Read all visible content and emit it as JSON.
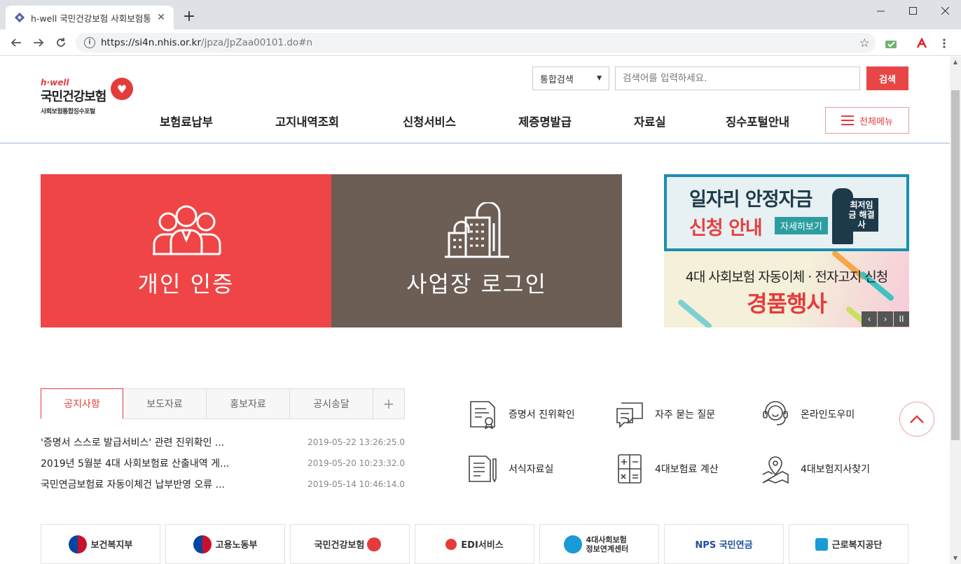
{
  "browser": {
    "tab_title": "h-well 국민건강보험 사회보험통",
    "url_host": "https://si4n.nhis.or.kr",
    "url_path": "/jpza/JpZaa00101.do#n"
  },
  "header": {
    "logo_hwell": "h·well",
    "logo_name": "국민건강보험",
    "logo_sub": "사회보험통합징수포털",
    "search_scope": "통합검색",
    "search_placeholder": "검색어를 입력하세요.",
    "search_button": "검색",
    "nav": [
      "보험료납부",
      "고지내역조회",
      "신청서비스",
      "제증명발급",
      "자료실",
      "징수포털안내"
    ],
    "all_menu": "전체메뉴"
  },
  "banners": {
    "personal": "개인 인증",
    "business": "사업장 로그인"
  },
  "promo": {
    "top_line1": "일자리 안정자금",
    "top_line2": "신청 안내",
    "top_pill": "자세히보기",
    "top_badge": "최저임금 해결사",
    "bottom_line1": "4대 사회보험 자동이체 · 전자고지 신청",
    "bottom_line2": "경품행사",
    "ctl_prev": "‹",
    "ctl_next": "›",
    "ctl_pause": "II"
  },
  "notice": {
    "tabs": [
      "공지사항",
      "보도자료",
      "홍보자료",
      "공시송달",
      "+"
    ],
    "items": [
      {
        "title": "'증명서 스스로 발급서비스' 관련 진위확인 ...",
        "date": "2019-05-22 13:26:25.0"
      },
      {
        "title": "2019년 5월분 4대 사회보험료 산출내역 게...",
        "date": "2019-05-20 10:23:32.0"
      },
      {
        "title": "국민연금보험료 자동이체건 납부반영 오류 ...",
        "date": "2019-05-14 10:46:14.0"
      }
    ]
  },
  "quick_links": [
    {
      "label": "증명서 진위확인",
      "icon": "certificate-icon"
    },
    {
      "label": "자주 묻는 질문",
      "icon": "faq-icon"
    },
    {
      "label": "온라인도우미",
      "icon": "headset-icon"
    },
    {
      "label": "서식자료실",
      "icon": "form-document-icon"
    },
    {
      "label": "4대보험료 계산",
      "icon": "calculator-icon"
    },
    {
      "label": "4대보험지사찾기",
      "icon": "map-pin-icon"
    }
  ],
  "family_sites": [
    "보건복지부",
    "고용노동부",
    "국민건강보험",
    "EDI서비스",
    "4대사회보험 정보연계센터",
    "NPS 국민연금",
    "근로복지공단"
  ],
  "colors": {
    "accent": "#ef4546",
    "business": "#6c5e55",
    "promo_top": "#1a8eb0"
  }
}
